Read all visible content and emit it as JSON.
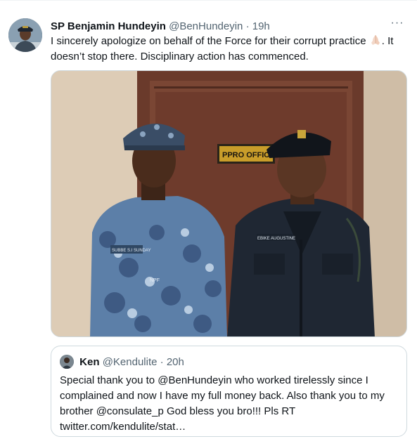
{
  "tweet": {
    "author_name": "SP Benjamin Hundeyin",
    "author_handle": "@BenHundeyin",
    "separator": "·",
    "time": "19h",
    "more_label": "···",
    "text_part1": "I sincerely apologize on behalf of the Force for their corrupt practice",
    "text_part2": ". It doesn’t stop there. Disciplinary action has commenced.",
    "emoji": "folded-hands-emoji",
    "photo": {
      "door_sign": "PPRO OFFIC",
      "nametag_left": "SUBBE S.I SUNDAY",
      "badge_left": "NPF",
      "nametag_right": "EBIKE AUGUSTINE"
    }
  },
  "quoted": {
    "author_name": "Ken",
    "author_handle": "@Kendulite",
    "separator": "·",
    "time": "20h",
    "text": "Special thank you to @BenHundeyin who worked tirelessly since I complained and now I have my full money back. Also thank you to my brother @consulate_p God bless you bro!!! Pls RT twitter.com/kendulite/stat…"
  },
  "colors": {
    "text_primary": "#0f1419",
    "text_secondary": "#536471",
    "border": "#cfd9de"
  }
}
